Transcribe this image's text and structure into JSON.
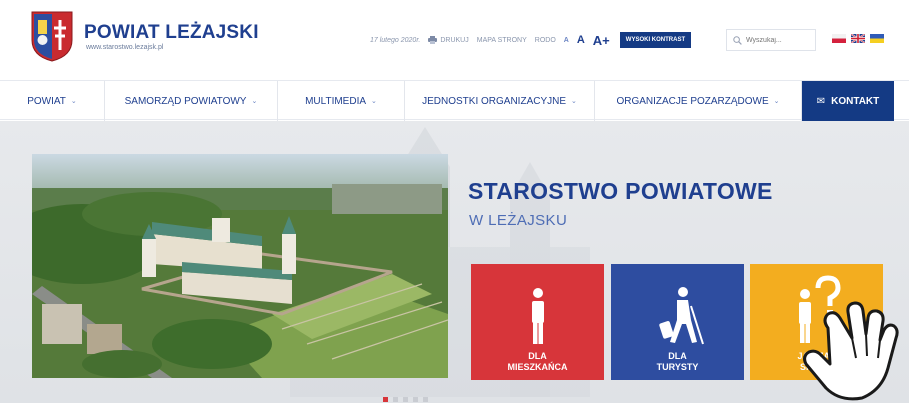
{
  "brand": {
    "title": "POWIAT LEŻAJSKI",
    "url": "www.starostwo.lezajsk.pl"
  },
  "utility": {
    "date": "17 lutego 2020r.",
    "print_label": "DRUKUJ",
    "sitemap_label": "MAPA STRONY",
    "rodo_label": "RODO",
    "font_small": "A",
    "font_medium": "A",
    "font_large": "A+",
    "contrast_label": "WYSOKI KONTRAST",
    "search_placeholder": "Wyszukaj..."
  },
  "languages": [
    "pl",
    "en",
    "ua"
  ],
  "nav": {
    "items": [
      {
        "label": "POWIAT"
      },
      {
        "label": "SAMORZĄD POWIATOWY"
      },
      {
        "label": "MULTIMEDIA"
      },
      {
        "label": "JEDNOSTKI ORGANIZACYJNE"
      },
      {
        "label": "ORGANIZACJE POZARZĄDOWE"
      }
    ],
    "contact_label": "KONTAKT"
  },
  "hero": {
    "title": "STAROSTWO POWIATOWE",
    "subtitle": "W LEŻAJSKU"
  },
  "tiles": [
    {
      "line1": "DLA",
      "line2": "MIESZKAŃCA",
      "color": "#d7353a",
      "icon": "person-icon"
    },
    {
      "line1": "DLA",
      "line2": "TURYSTY",
      "color": "#2e4da0",
      "icon": "tourist-icon"
    },
    {
      "line1": "JAK ZAŁ",
      "line2": "SPRAW",
      "color": "#f3ad1f",
      "icon": "question-person-icon"
    }
  ],
  "slider": {
    "count": 5,
    "active": 1
  },
  "colors": {
    "primary": "#1f3f8f",
    "dark_blue": "#143a84",
    "red": "#d7353a",
    "yellow": "#f3ad1f"
  }
}
